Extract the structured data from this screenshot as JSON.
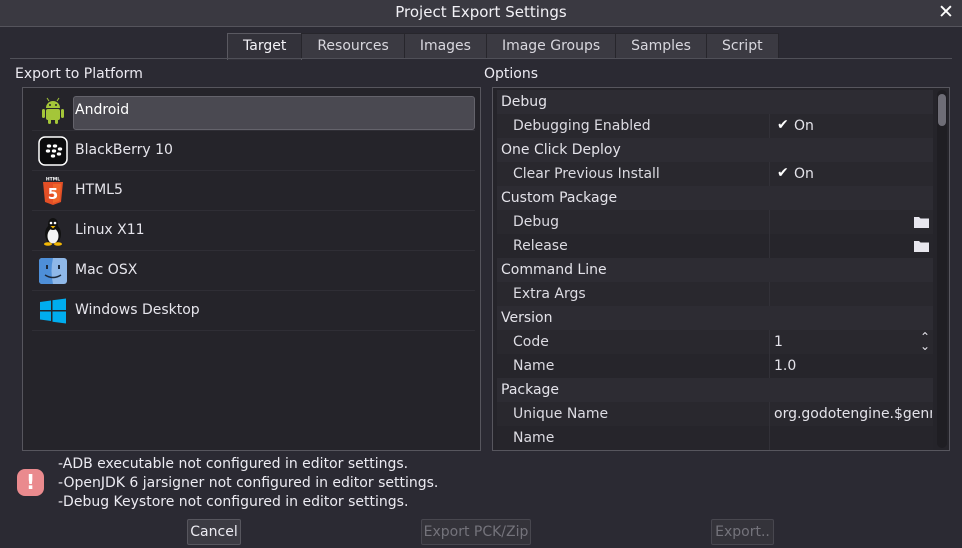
{
  "window": {
    "title": "Project Export Settings",
    "close_glyph": "✕"
  },
  "tabs": [
    {
      "label": "Target",
      "active": true
    },
    {
      "label": "Resources"
    },
    {
      "label": "Images"
    },
    {
      "label": "Image Groups"
    },
    {
      "label": "Samples"
    },
    {
      "label": "Script"
    }
  ],
  "platforms_section": {
    "label": "Export to Platform",
    "items": [
      {
        "label": "Android",
        "icon": "android-icon",
        "selected": true
      },
      {
        "label": "BlackBerry 10",
        "icon": "blackberry-icon"
      },
      {
        "label": "HTML5",
        "icon": "html5-icon"
      },
      {
        "label": "Linux X11",
        "icon": "linux-tux-icon"
      },
      {
        "label": "Mac OSX",
        "icon": "mac-finder-icon"
      },
      {
        "label": "Windows Desktop",
        "icon": "windows-icon"
      }
    ]
  },
  "options_section": {
    "label": "Options",
    "rows": [
      {
        "kind": "category",
        "label": "Debug"
      },
      {
        "kind": "property",
        "label": "Debugging Enabled",
        "type": "check",
        "check_glyph": "✔",
        "value": "On"
      },
      {
        "kind": "category",
        "label": "One Click Deploy"
      },
      {
        "kind": "property",
        "label": "Clear Previous Install",
        "type": "check",
        "check_glyph": "✔",
        "value": "On"
      },
      {
        "kind": "category",
        "label": "Custom Package"
      },
      {
        "kind": "property",
        "label": "Debug",
        "type": "file",
        "value": ""
      },
      {
        "kind": "property",
        "label": "Release",
        "type": "file",
        "value": ""
      },
      {
        "kind": "category",
        "label": "Command Line"
      },
      {
        "kind": "property",
        "label": "Extra Args",
        "type": "text",
        "value": ""
      },
      {
        "kind": "category",
        "label": "Version"
      },
      {
        "kind": "property",
        "label": "Code",
        "type": "spin",
        "value": "1"
      },
      {
        "kind": "property",
        "label": "Name",
        "type": "text",
        "value": "1.0"
      },
      {
        "kind": "category",
        "label": "Package"
      },
      {
        "kind": "property",
        "label": "Unique Name",
        "type": "text",
        "value": "org.godotengine.$genname"
      },
      {
        "kind": "property",
        "label": "Name",
        "type": "text",
        "value": ""
      }
    ]
  },
  "errors": {
    "icon": "error-icon",
    "badge_glyph": "!",
    "lines": [
      "-ADB executable not configured in editor settings.",
      "-OpenJDK 6 jarsigner not configured in editor settings.",
      "-Debug Keystore not configured in editor settings."
    ]
  },
  "buttons": {
    "cancel": "Cancel",
    "export_pck": "Export PCK/Zip",
    "export": "Export.."
  },
  "colors": {
    "background": "#2b2a33",
    "panel": "#25242a",
    "selected": "#4a4951",
    "error": "#ea8a8e",
    "android_green": "#a4c639",
    "html5_orange": "#e34f26",
    "windows_blue": "#00adef"
  }
}
